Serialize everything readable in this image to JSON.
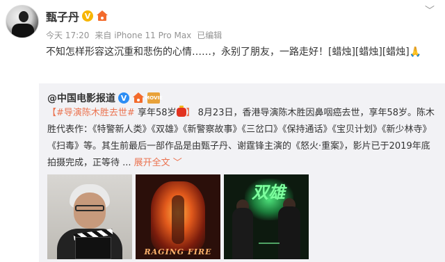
{
  "post": {
    "username": "甄子丹",
    "verified_badge": "V",
    "more_icon": "chevron-down-icon",
    "meta": {
      "time": "今天 17:20",
      "source": "来自 iPhone 11 Pro Max",
      "edited": "已编辑"
    },
    "text": "不知怎样形容这沉重和悲伤的心情……，永别了朋友，一路走好！[蜡烛][蜡烛][蜡烛]🙏"
  },
  "repost": {
    "username": "@中国电影报道",
    "verified_badge": "V",
    "movie_badge": "MOVIE",
    "hashtag": "#导演陈木胜去世#",
    "hashtag_suffix": " 享年58岁",
    "body": " 8月23日，香港导演陈木胜因鼻咽癌去世，享年58岁。陈木胜代表作：《特警新人类》《双雄》《新警察故事》《三岔口》《保持通话》《宝贝计划》《新少林寺》《扫毒》等。其生前最后一部作品是由甄子丹、谢霆锋主演的《怒火·重案》，影片已于2019年底拍摄完成，正等待 ...",
    "expand_label": "展开全文 ﹀",
    "images": [
      {
        "name": "director-photo",
        "caption": ""
      },
      {
        "name": "raging-fire-poster",
        "caption": "RAGING FIRE"
      },
      {
        "name": "double-hero-poster",
        "caption": "双雄"
      }
    ]
  }
}
